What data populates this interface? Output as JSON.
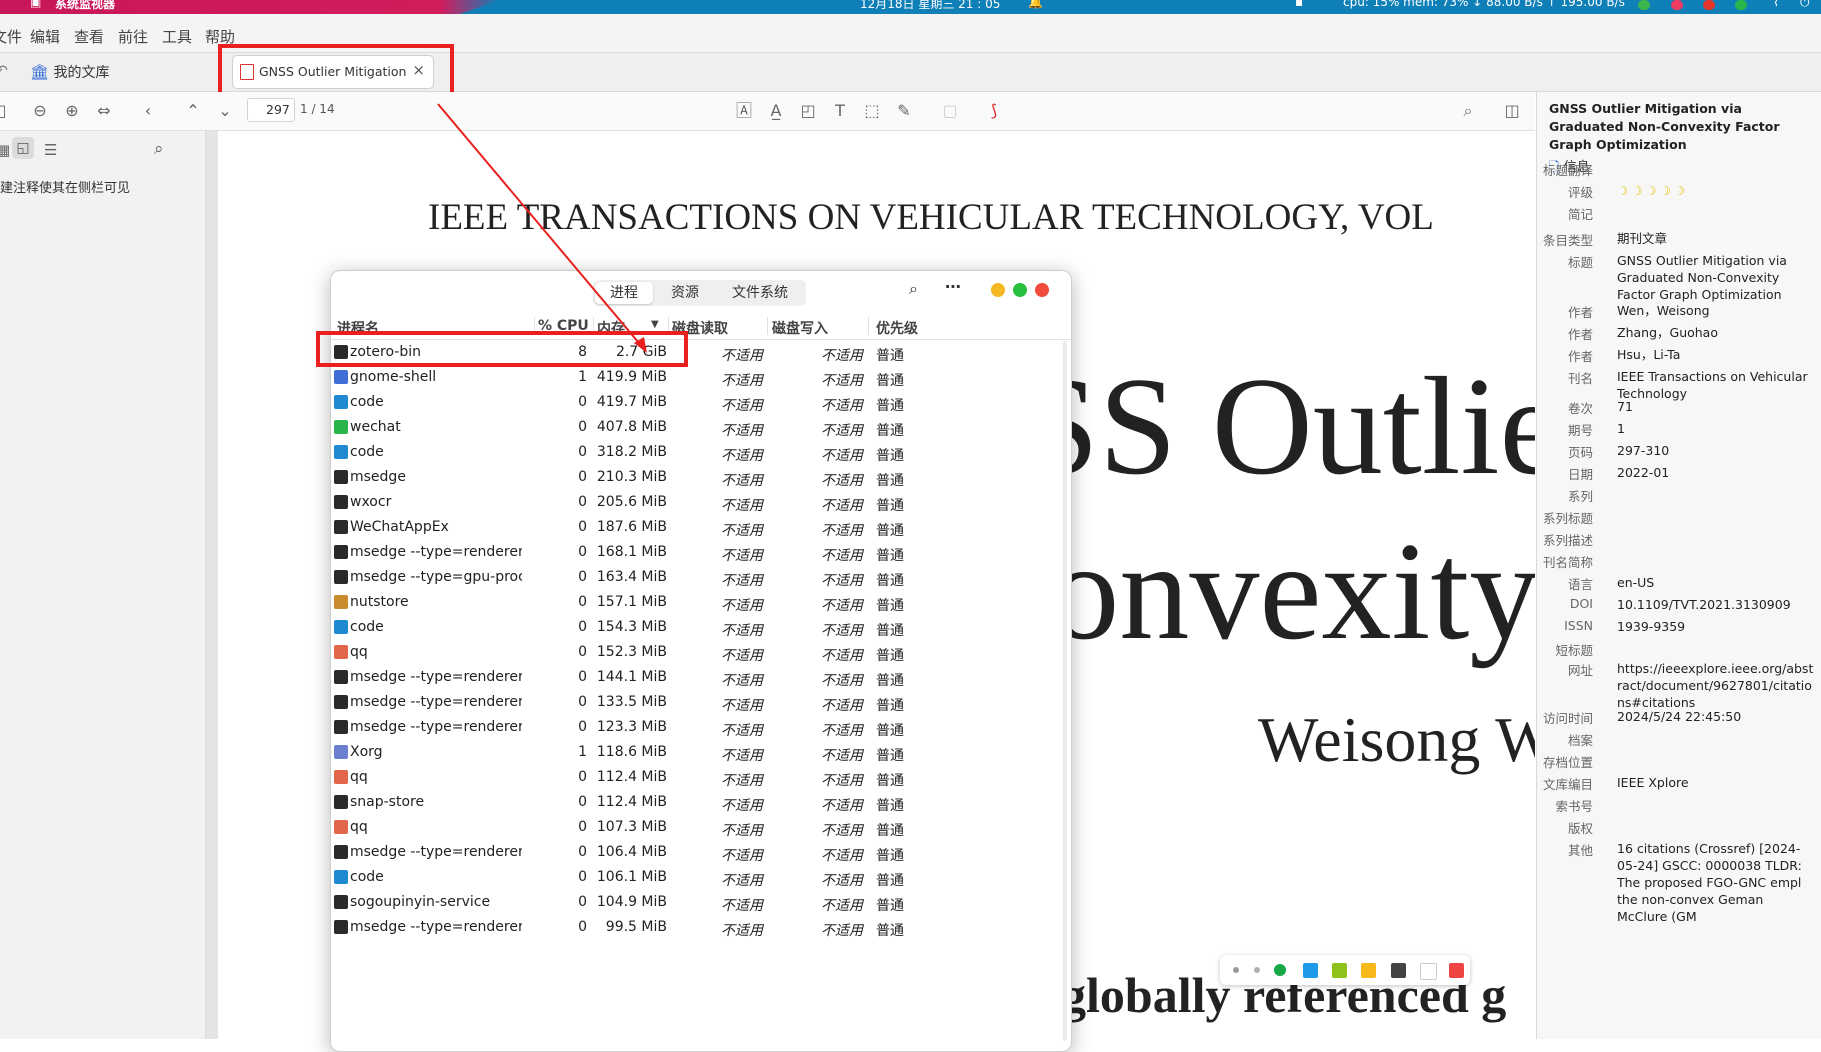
{
  "topbar": {
    "app_name": "系统监视器",
    "datetime": "12月18日 星期三 21 : 05",
    "stats": "cpu: 15% mem: 73% ↓ 88.00 B/s ↑ 195.00 B/s"
  },
  "menubar": {
    "items": [
      "文件",
      "编辑",
      "查看",
      "前往",
      "工具",
      "帮助"
    ]
  },
  "tabs": {
    "library": "我的文库",
    "document": "GNSS Outlier Mitigation via",
    "close_glyph": "×"
  },
  "pdf_toolbar": {
    "page_value": "297",
    "page_count": "1 / 14"
  },
  "left_sidebar": {
    "hint": "建注释使其在侧栏可见"
  },
  "pdf_content": {
    "header": "IEEE TRANSACTIONS ON VEHICULAR TECHNOLOGY, VOL",
    "title_line1": "SS Outlie",
    "title_line2": "Convexity",
    "authors": "Weisong W",
    "body_line": "globally referenced g"
  },
  "monitor": {
    "tabs": [
      "进程",
      "资源",
      "文件系统"
    ],
    "columns": [
      "进程名",
      "% CPU",
      "内存",
      "磁盘读取",
      "磁盘写入",
      "优先级"
    ],
    "processes": [
      {
        "name": "zotero-bin",
        "cpu": "8",
        "mem": "2.7 GiB",
        "read": "不适用",
        "write": "不适用",
        "priority": "普通",
        "icon": "dark"
      },
      {
        "name": "gnome-shell",
        "cpu": "1",
        "mem": "419.9 MiB",
        "read": "不适用",
        "write": "不适用",
        "priority": "普通",
        "icon": "gnome"
      },
      {
        "name": "code",
        "cpu": "0",
        "mem": "419.7 MiB",
        "read": "不适用",
        "write": "不适用",
        "priority": "普通",
        "icon": "vscode"
      },
      {
        "name": "wechat",
        "cpu": "0",
        "mem": "407.8 MiB",
        "read": "不适用",
        "write": "不适用",
        "priority": "普通",
        "icon": "wechat"
      },
      {
        "name": "code",
        "cpu": "0",
        "mem": "318.2 MiB",
        "read": "不适用",
        "write": "不适用",
        "priority": "普通",
        "icon": "vscode"
      },
      {
        "name": "msedge",
        "cpu": "0",
        "mem": "210.3 MiB",
        "read": "不适用",
        "write": "不适用",
        "priority": "普通",
        "icon": "dark"
      },
      {
        "name": "wxocr",
        "cpu": "0",
        "mem": "205.6 MiB",
        "read": "不适用",
        "write": "不适用",
        "priority": "普通",
        "icon": "dark"
      },
      {
        "name": "WeChatAppEx",
        "cpu": "0",
        "mem": "187.6 MiB",
        "read": "不适用",
        "write": "不适用",
        "priority": "普通",
        "icon": "dark"
      },
      {
        "name": "msedge --type=renderer --s",
        "cpu": "0",
        "mem": "168.1 MiB",
        "read": "不适用",
        "write": "不适用",
        "priority": "普通",
        "icon": "dark"
      },
      {
        "name": "msedge --type=gpu-process",
        "cpu": "0",
        "mem": "163.4 MiB",
        "read": "不适用",
        "write": "不适用",
        "priority": "普通",
        "icon": "dark"
      },
      {
        "name": "nutstore",
        "cpu": "0",
        "mem": "157.1 MiB",
        "read": "不适用",
        "write": "不适用",
        "priority": "普通",
        "icon": "nutstore"
      },
      {
        "name": "code",
        "cpu": "0",
        "mem": "154.3 MiB",
        "read": "不适用",
        "write": "不适用",
        "priority": "普通",
        "icon": "vscode"
      },
      {
        "name": "qq",
        "cpu": "0",
        "mem": "152.3 MiB",
        "read": "不适用",
        "write": "不适用",
        "priority": "普通",
        "icon": "qq"
      },
      {
        "name": "msedge --type=renderer --s",
        "cpu": "0",
        "mem": "144.1 MiB",
        "read": "不适用",
        "write": "不适用",
        "priority": "普通",
        "icon": "dark"
      },
      {
        "name": "msedge --type=renderer --s",
        "cpu": "0",
        "mem": "133.5 MiB",
        "read": "不适用",
        "write": "不适用",
        "priority": "普通",
        "icon": "dark"
      },
      {
        "name": "msedge --type=renderer --s",
        "cpu": "0",
        "mem": "123.3 MiB",
        "read": "不适用",
        "write": "不适用",
        "priority": "普通",
        "icon": "dark"
      },
      {
        "name": "Xorg",
        "cpu": "1",
        "mem": "118.6 MiB",
        "read": "不适用",
        "write": "不适用",
        "priority": "普通",
        "icon": "xorg"
      },
      {
        "name": "qq",
        "cpu": "0",
        "mem": "112.4 MiB",
        "read": "不适用",
        "write": "不适用",
        "priority": "普通",
        "icon": "qq"
      },
      {
        "name": "snap-store",
        "cpu": "0",
        "mem": "112.4 MiB",
        "read": "不适用",
        "write": "不适用",
        "priority": "普通",
        "icon": "dark"
      },
      {
        "name": "qq",
        "cpu": "0",
        "mem": "107.3 MiB",
        "read": "不适用",
        "write": "不适用",
        "priority": "普通",
        "icon": "qq"
      },
      {
        "name": "msedge --type=renderer --s",
        "cpu": "0",
        "mem": "106.4 MiB",
        "read": "不适用",
        "write": "不适用",
        "priority": "普通",
        "icon": "dark"
      },
      {
        "name": "code",
        "cpu": "0",
        "mem": "106.1 MiB",
        "read": "不适用",
        "write": "不适用",
        "priority": "普通",
        "icon": "vscode"
      },
      {
        "name": "sogoupinyin-service",
        "cpu": "0",
        "mem": "104.9 MiB",
        "read": "不适用",
        "write": "不适用",
        "priority": "普通",
        "icon": "dark"
      },
      {
        "name": "msedge --type=renderer --s",
        "cpu": "0",
        "mem": "99.5 MiB",
        "read": "不适用",
        "write": "不适用",
        "priority": "普通",
        "icon": "dark"
      }
    ]
  },
  "info_panel": {
    "title": "GNSS Outlier Mitigation via Graduated Non-Convexity Factor Graph Optimization",
    "section": "信息",
    "fields": [
      {
        "label": "标题翻译",
        "value": ""
      },
      {
        "label": "评级",
        "value": "☽☽☽☽☽"
      },
      {
        "label": "简记",
        "value": ""
      },
      {
        "label": "条目类型",
        "value": "期刊文章"
      },
      {
        "label": "标题",
        "value": "GNSS Outlier Mitigation via Graduated Non-Convexity Factor Graph Optimization"
      },
      {
        "label": "作者",
        "value": "Wen，Weisong"
      },
      {
        "label": "作者",
        "value": "Zhang，Guohao"
      },
      {
        "label": "作者",
        "value": "Hsu，Li-Ta"
      },
      {
        "label": "刊名",
        "value": "IEEE Transactions on Vehicular Technology"
      },
      {
        "label": "卷次",
        "value": "71"
      },
      {
        "label": "期号",
        "value": "1"
      },
      {
        "label": "页码",
        "value": "297-310"
      },
      {
        "label": "日期",
        "value": "2022-01"
      },
      {
        "label": "系列",
        "value": ""
      },
      {
        "label": "系列标题",
        "value": ""
      },
      {
        "label": "系列描述",
        "value": ""
      },
      {
        "label": "刊名简称",
        "value": ""
      },
      {
        "label": "语言",
        "value": "en-US"
      },
      {
        "label": "DOI",
        "value": "10.1109/TVT.2021.3130909"
      },
      {
        "label": "ISSN",
        "value": "1939-9359"
      },
      {
        "label": "短标题",
        "value": ""
      },
      {
        "label": "网址",
        "value": "https://ieeexplore.ieee.org/abstract/document/9627801/citations#citations"
      },
      {
        "label": "访问时间",
        "value": "2024/5/24 22:45:50"
      },
      {
        "label": "档案",
        "value": ""
      },
      {
        "label": "存档位置",
        "value": ""
      },
      {
        "label": "文库编目",
        "value": "IEEE Xplore"
      },
      {
        "label": "索书号",
        "value": ""
      },
      {
        "label": "版权",
        "value": ""
      },
      {
        "label": "其他",
        "value": "16 citations (Crossref) [2024-05-24] GSCC: 0000038 TLDR: The proposed FGO-GNC empl the non-convex Geman McClure (GM"
      }
    ]
  },
  "colors": {
    "highlight": "#e8201e",
    "accent": "#0f7fb8",
    "palette": [
      "#999999",
      "#b0b0b0",
      "#18a848",
      "#1e9be8",
      "#8ec21a",
      "#f6b81a",
      "#444444",
      "#ffffff",
      "#ee4444"
    ]
  }
}
